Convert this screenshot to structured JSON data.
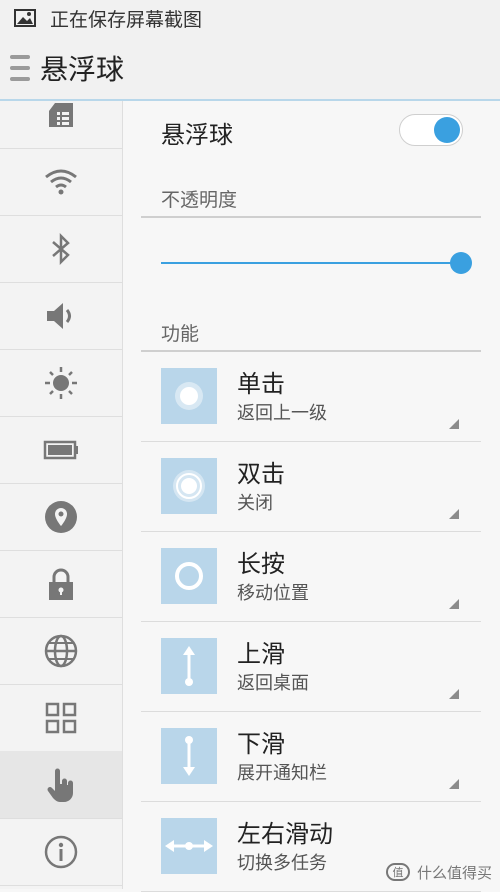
{
  "status_bar": {
    "text": "正在保存屏幕截图",
    "icon": "image-icon"
  },
  "title_bar": {
    "title": "悬浮球",
    "icon": "menu-handle-icon"
  },
  "sidebar": {
    "items": [
      {
        "name": "sim-card",
        "icon": "sim-card-icon"
      },
      {
        "name": "wifi",
        "icon": "wifi-icon"
      },
      {
        "name": "bluetooth",
        "icon": "bluetooth-icon"
      },
      {
        "name": "sound",
        "icon": "speaker-icon"
      },
      {
        "name": "brightness",
        "icon": "sun-icon"
      },
      {
        "name": "battery",
        "icon": "battery-icon"
      },
      {
        "name": "location",
        "icon": "location-pin-icon"
      },
      {
        "name": "security",
        "icon": "lock-icon"
      },
      {
        "name": "language",
        "icon": "globe-icon"
      },
      {
        "name": "apps",
        "icon": "grid-icon"
      },
      {
        "name": "gesture",
        "icon": "hand-pointer-icon",
        "selected": true
      },
      {
        "name": "about",
        "icon": "info-icon"
      }
    ]
  },
  "floating_ball": {
    "label": "悬浮球",
    "enabled": true,
    "accent": "#3aa0e0"
  },
  "opacity": {
    "label": "不透明度",
    "value_fraction": 1.0
  },
  "functions": {
    "label": "功能",
    "items": [
      {
        "name": "单击",
        "value": "返回上一级",
        "icon": "single-tap-icon"
      },
      {
        "name": "双击",
        "value": "关闭",
        "icon": "double-tap-icon"
      },
      {
        "name": "长按",
        "value": "移动位置",
        "icon": "long-press-icon"
      },
      {
        "name": "上滑",
        "value": "返回桌面",
        "icon": "swipe-up-icon"
      },
      {
        "name": "下滑",
        "value": "展开通知栏",
        "icon": "swipe-down-icon"
      },
      {
        "name": "左右滑动",
        "value": "切换多任务",
        "icon": "swipe-horizontal-icon"
      }
    ]
  },
  "watermark": {
    "text": "什么值得买"
  }
}
